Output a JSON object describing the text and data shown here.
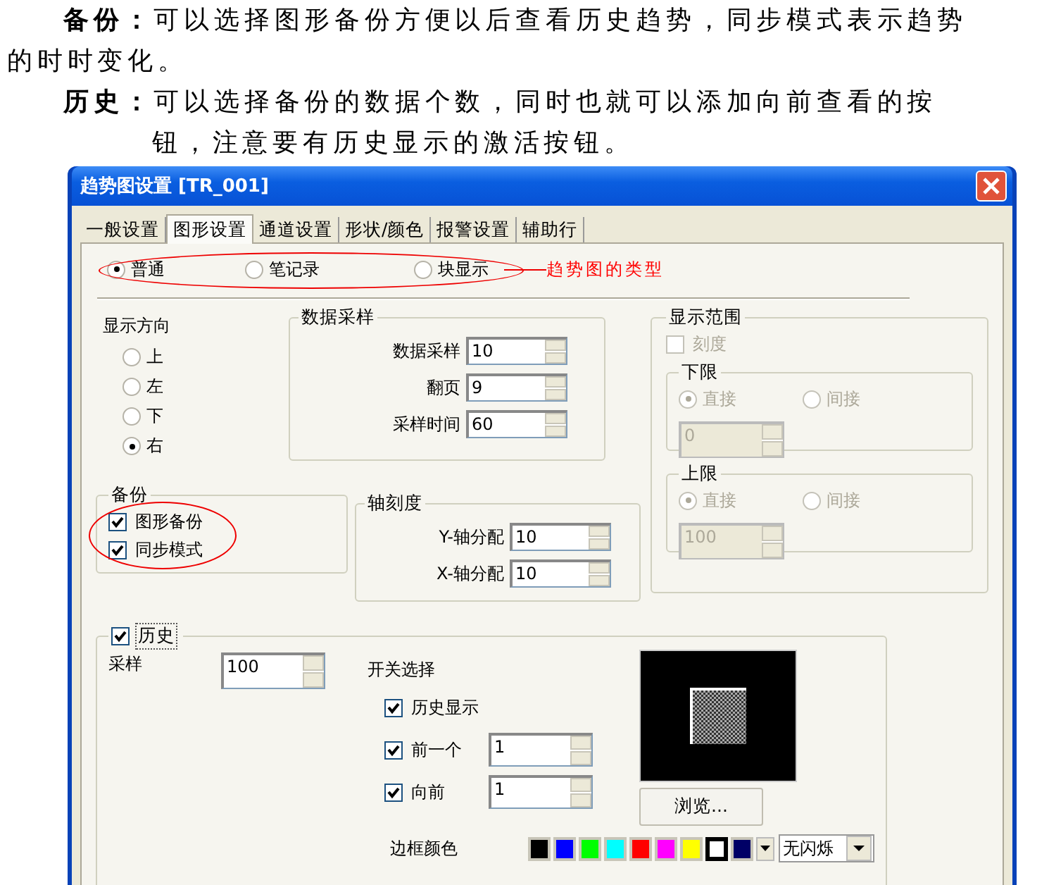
{
  "intro": [
    {
      "label": "备份：",
      "text": "可以选择图形备份方便以后查看历史趋势，同步模式表示趋势的时时变化。",
      "kind": "flush"
    },
    {
      "label": "历史：",
      "text": "可以选择备份的数据个数，同时也就可以添加向前查看的按钮，注意要有历史显示的激活按钮。",
      "kind": "hanging"
    }
  ],
  "window": {
    "title": "趋势图设置 [TR_001]"
  },
  "tabs": [
    {
      "label": "一般设置",
      "selected": false
    },
    {
      "label": "图形设置",
      "selected": true
    },
    {
      "label": "通道设置",
      "selected": false
    },
    {
      "label": "形状/颜色",
      "selected": false
    },
    {
      "label": "报警设置",
      "selected": false
    },
    {
      "label": "辅助行",
      "selected": false
    }
  ],
  "chart_types": [
    {
      "label": "普通",
      "selected": true
    },
    {
      "label": "笔记录",
      "selected": false
    },
    {
      "label": "块显示",
      "selected": false
    }
  ],
  "annotation": "趋势图的类型",
  "direction": {
    "title": "显示方向",
    "options": [
      {
        "label": "上",
        "selected": false
      },
      {
        "label": "左",
        "selected": false
      },
      {
        "label": "下",
        "selected": false
      },
      {
        "label": "右",
        "selected": true
      }
    ]
  },
  "sampling": {
    "title": "数据采样",
    "fields": [
      {
        "label": "数据采样",
        "value": "10"
      },
      {
        "label": "翻页",
        "value": "9"
      },
      {
        "label": "采样时间",
        "value": "60"
      }
    ]
  },
  "backup": {
    "title": "备份",
    "options": [
      {
        "label": "图形备份",
        "checked": true
      },
      {
        "label": "同步模式",
        "checked": true
      }
    ]
  },
  "axis": {
    "title": "轴刻度",
    "fields": [
      {
        "label": "Y-轴分配",
        "value": "10"
      },
      {
        "label": "X-轴分配",
        "value": "10"
      }
    ]
  },
  "range": {
    "title": "显示范围",
    "disabled": true,
    "scale": {
      "label": "刻度",
      "checked": false
    },
    "limits": [
      {
        "title": "下限",
        "value": "0",
        "options": [
          {
            "label": "直接",
            "selected": true
          },
          {
            "label": "间接",
            "selected": false
          }
        ]
      },
      {
        "title": "上限",
        "value": "100",
        "options": [
          {
            "label": "直接",
            "selected": true
          },
          {
            "label": "间接",
            "selected": false
          }
        ]
      }
    ]
  },
  "history": {
    "title": "历史",
    "checked": true,
    "sample_label": "采样",
    "sample_value": "100",
    "switch_title": "开关选择",
    "switches": [
      {
        "label": "历史显示",
        "checked": true,
        "kind": "plain"
      },
      {
        "label": "前一个",
        "checked": true,
        "kind": "spin",
        "value": "1"
      },
      {
        "label": "向前",
        "checked": true,
        "kind": "spin",
        "value": "1"
      }
    ],
    "browse": "浏览...",
    "border_label": "边框颜色",
    "colors": [
      {
        "color": "#000000",
        "selected": false
      },
      {
        "color": "#0000ff",
        "selected": false
      },
      {
        "color": "#00ff00",
        "selected": false
      },
      {
        "color": "#00ffff",
        "selected": false
      },
      {
        "color": "#ff0000",
        "selected": false
      },
      {
        "color": "#ff00ff",
        "selected": false
      },
      {
        "color": "#ffff00",
        "selected": false
      },
      {
        "color": "#ffffff",
        "selected": true
      },
      {
        "color": "#000066",
        "selected": false
      }
    ],
    "blink": "无闪烁"
  }
}
